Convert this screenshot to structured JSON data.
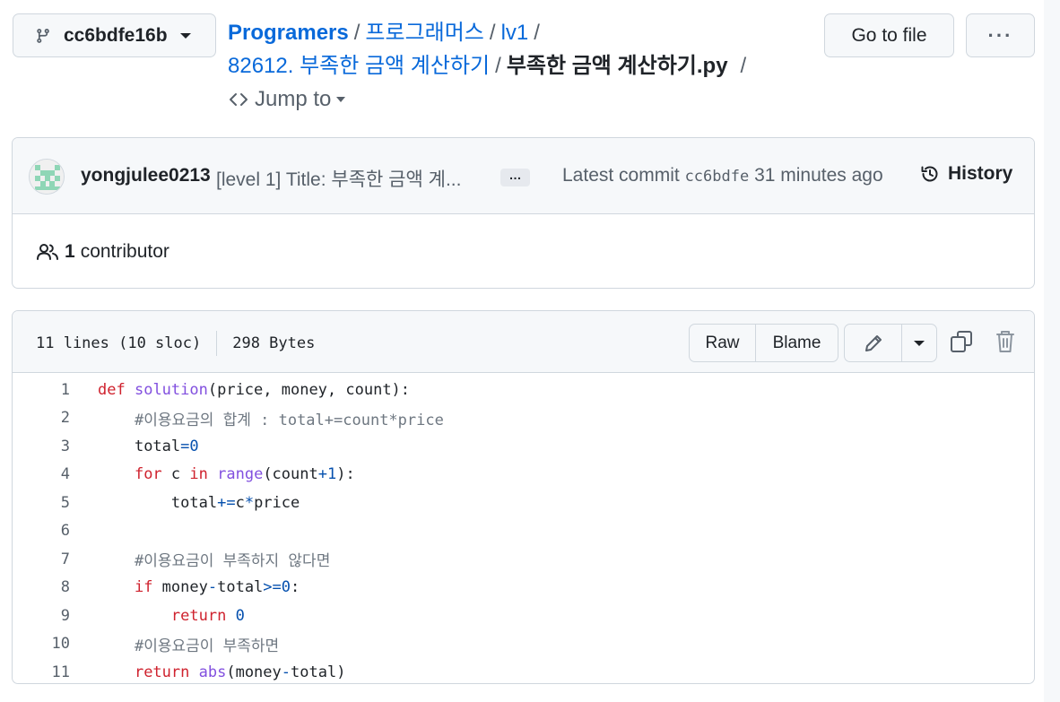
{
  "branch": {
    "name": "cc6bdfe16b",
    "icon": "git-branch-icon"
  },
  "breadcrumb": {
    "repo": "Programers",
    "folder1": "프로그래머스",
    "folder2": "lv1",
    "folder3": "82612. 부족한 금액 계산하기",
    "file": "부족한 금액 계산하기.py",
    "sep": "/",
    "jump_to": "Jump to"
  },
  "header_buttons": {
    "go_to_file": "Go to file",
    "more": "···"
  },
  "commit": {
    "user": "yongjulee0213",
    "message": "[level 1] Title: 부족한 금액 계...",
    "expand": "…",
    "latest_label": "Latest commit",
    "sha": "cc6bdfe",
    "time": "31 minutes ago",
    "history": "History"
  },
  "contributors": {
    "count": "1",
    "label": "contributor"
  },
  "file": {
    "lines": "11 lines (10 sloc)",
    "size": "298 Bytes",
    "raw": "Raw",
    "blame": "Blame"
  },
  "code_lines": [
    {
      "n": "1"
    },
    {
      "n": "2"
    },
    {
      "n": "3"
    },
    {
      "n": "4"
    },
    {
      "n": "5"
    },
    {
      "n": "6"
    },
    {
      "n": "7"
    },
    {
      "n": "8"
    },
    {
      "n": "9"
    },
    {
      "n": "10"
    },
    {
      "n": "11"
    }
  ],
  "code": {
    "l1": [
      "def",
      " ",
      "solution",
      "(price, money, count):"
    ],
    "l2": "#이용요금의 합계 : total+=count*price",
    "l3": [
      "total",
      "=",
      "0"
    ],
    "l4": [
      "for",
      " c ",
      "in",
      " ",
      "range",
      "(count",
      "+",
      "1",
      "):"
    ],
    "l5": [
      "total",
      "+=",
      "c",
      "*",
      "price"
    ],
    "l7": "#이용요금이 부족하지 않다면",
    "l8": [
      "if",
      " money",
      "-",
      "total",
      ">=",
      "0",
      ":"
    ],
    "l9": [
      "return",
      " ",
      "0"
    ],
    "l10": "#이용요금이 부족하면",
    "l11": [
      "return",
      " ",
      "abs",
      "(money",
      "-",
      "total)"
    ]
  },
  "colors": {
    "link": "#0969da",
    "keyword": "#cf222e",
    "function": "#8250df",
    "number": "#0550ae",
    "comment": "#6e7781"
  }
}
